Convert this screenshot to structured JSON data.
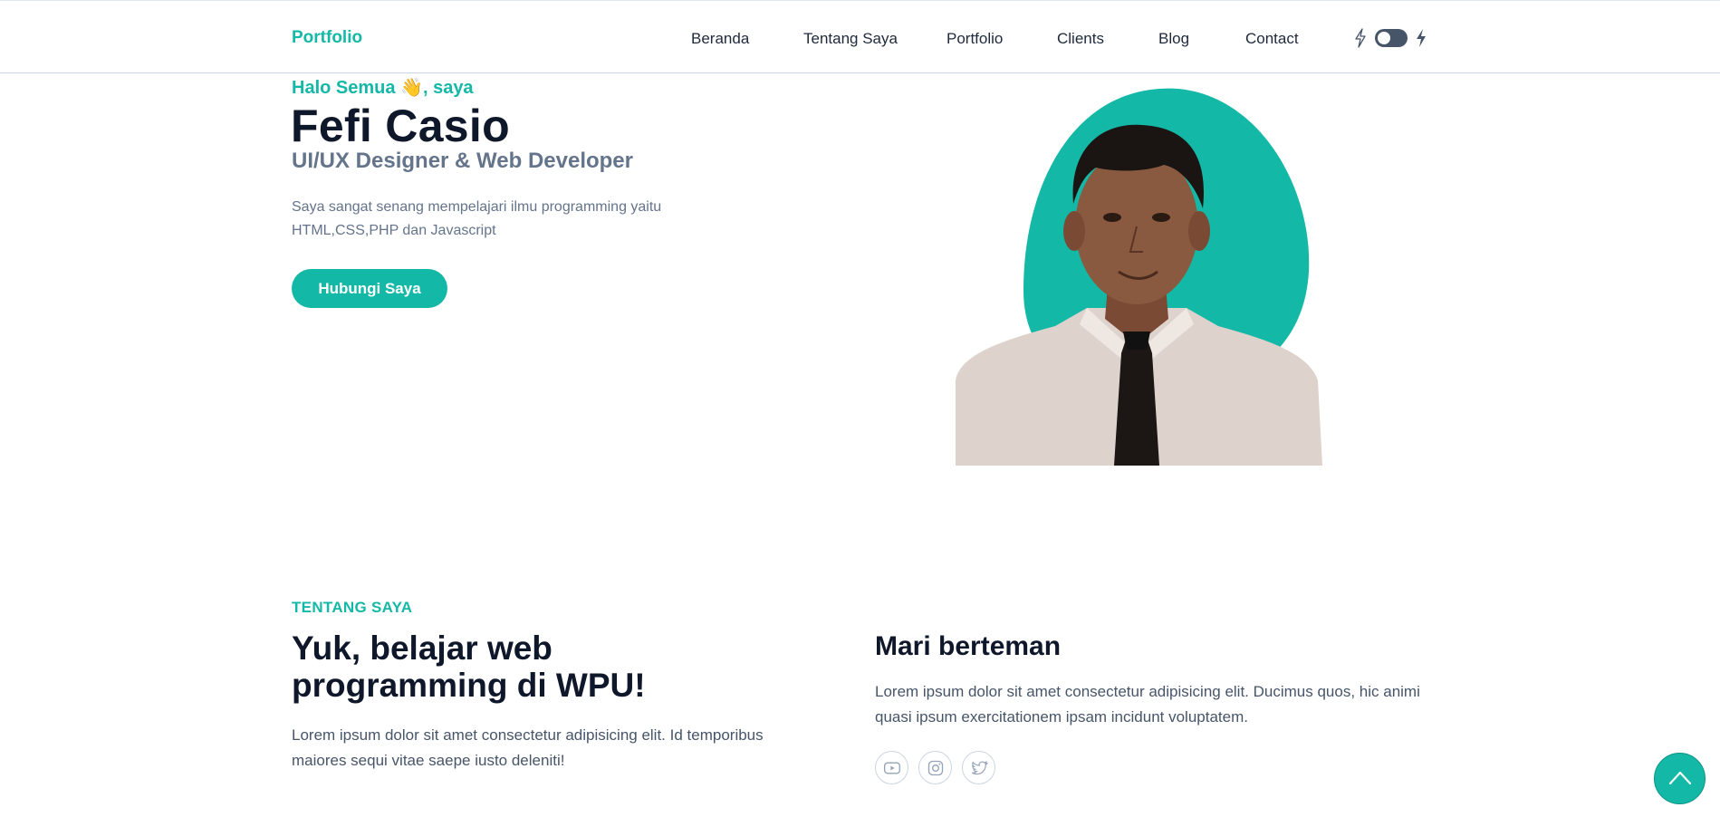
{
  "header": {
    "brand": "Portfolio",
    "nav": [
      "Beranda",
      "Tentang Saya",
      "Portfolio",
      "Clients",
      "Blog",
      "Contact"
    ],
    "theme_toggle": {
      "state": "off"
    }
  },
  "hero": {
    "greeting": "Halo Semua",
    "greeting_emoji": "👋",
    "greeting_suffix": ", saya",
    "name": "Fefi Casio",
    "role": "UI/UX Designer & Web Developer",
    "bio": "Saya sangat senang mempelajari ilmu programming yaitu HTML,CSS,PHP dan Javascript",
    "cta_label": "Hubungi Saya"
  },
  "about": {
    "eyebrow": "TENTANG SAYA",
    "title": "Yuk, belajar web programming di WPU!",
    "text": "Lorem ipsum dolor sit amet consectetur adipisicing elit. Id temporibus maiores sequi vitae saepe iusto deleniti!",
    "friend_title": "Mari berteman",
    "friend_text": "Lorem ipsum dolor sit amet consectetur adipisicing elit. Ducimus quos, hic animi quasi ipsum exercitationem ipsam incidunt voluptatem.",
    "socials": [
      "youtube-icon",
      "instagram-icon",
      "twitter-icon"
    ]
  },
  "colors": {
    "accent": "#14b8a6",
    "heading": "#0f172a",
    "muted": "#64748b",
    "toggle": "#475569"
  }
}
